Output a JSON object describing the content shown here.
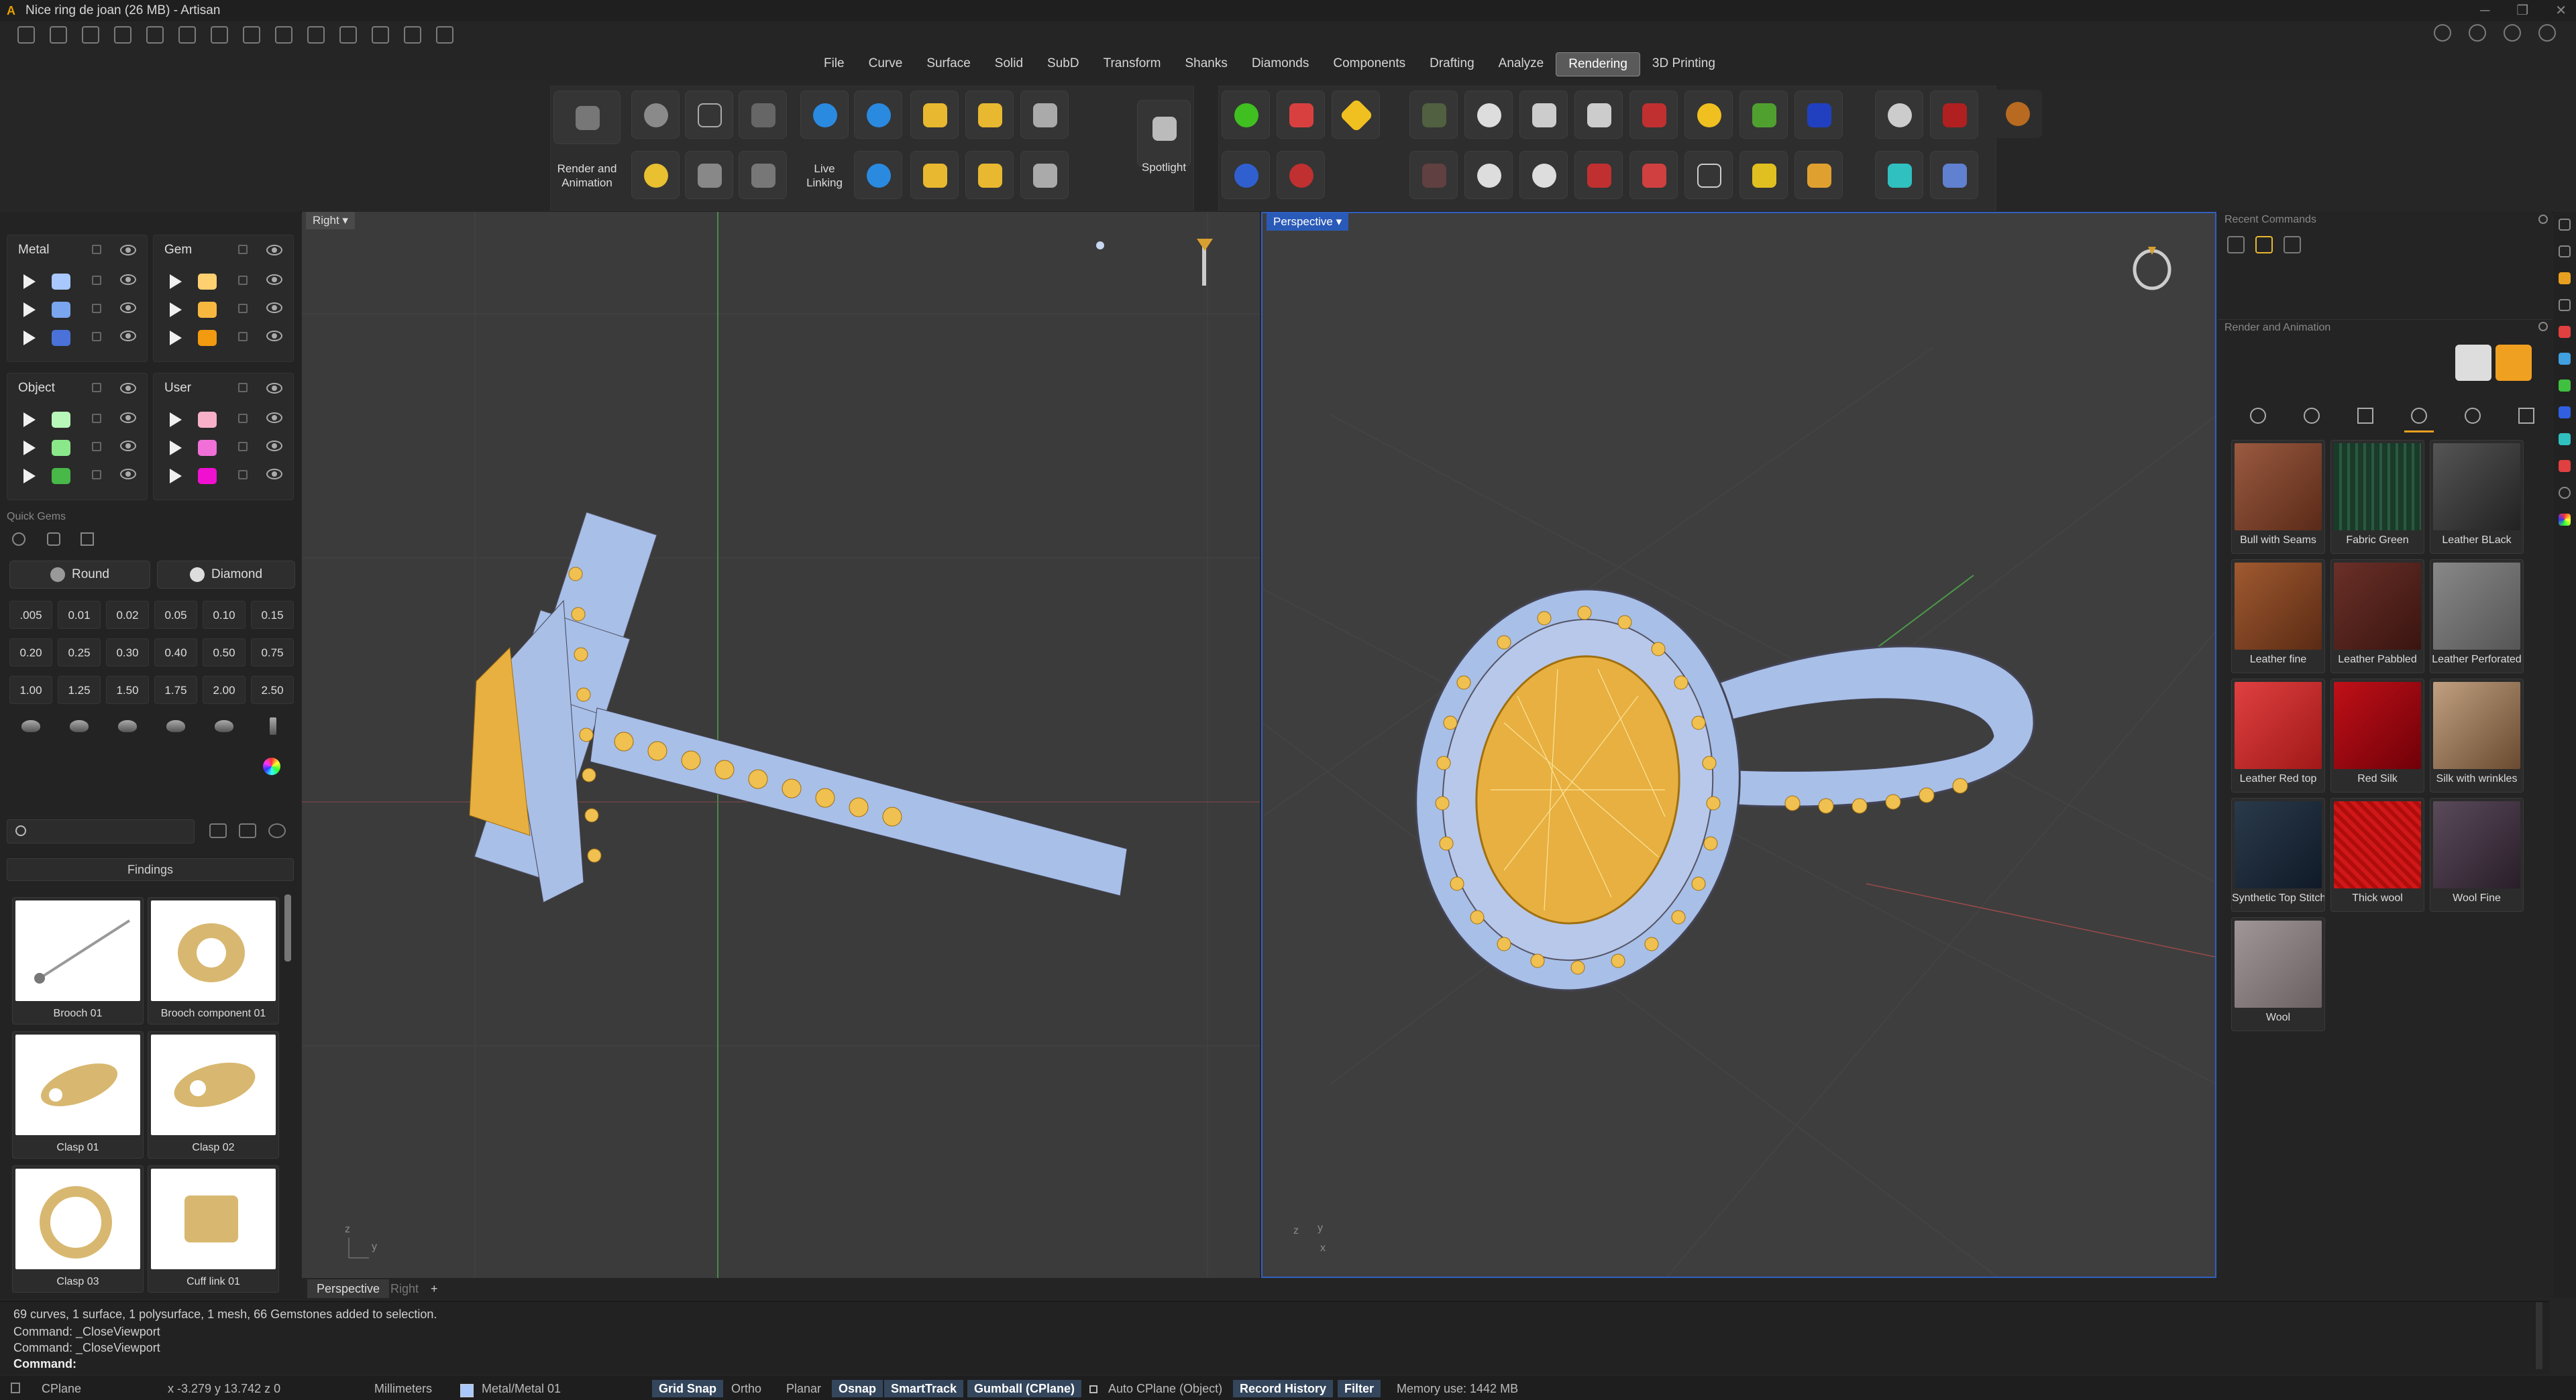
{
  "titlebar": {
    "title": "Nice ring de joan (26 MB) - Artisan"
  },
  "menu": [
    "File",
    "Curve",
    "Surface",
    "Solid",
    "SubD",
    "Transform",
    "Shanks",
    "Diamonds",
    "Components",
    "Drafting",
    "Analyze",
    "Rendering",
    "3D Printing"
  ],
  "active_menu": "Rendering",
  "ribbon": {
    "render_label": "Render and\nAnimation",
    "live_label": "Live\nLinking",
    "spotlight_label": "Spotlight"
  },
  "layers": {
    "metal": {
      "title": "Metal",
      "colors": [
        "#a8c8ff",
        "#7aa6f0",
        "#4a72d8"
      ]
    },
    "gem": {
      "title": "Gem",
      "colors": [
        "#ffd070",
        "#f8b840",
        "#f29a10"
      ]
    },
    "object": {
      "title": "Object",
      "colors": [
        "#b8f8b8",
        "#8ae88a",
        "#48b848"
      ]
    },
    "user": {
      "title": "User",
      "colors": [
        "#f8b0c8",
        "#f070d8",
        "#f010d0"
      ]
    }
  },
  "quickgems": {
    "header": "Quick Gems",
    "cut": "Round",
    "material": "Diamond",
    "sizes": [
      ".005",
      "0.01",
      "0.02",
      "0.05",
      "0.10",
      "0.15",
      "0.20",
      "0.25",
      "0.30",
      "0.40",
      "0.50",
      "0.75",
      "1.00",
      "1.25",
      "1.50",
      "1.75",
      "2.00",
      "2.50"
    ]
  },
  "library": {
    "search_placeholder": "",
    "category": "Findings",
    "items": [
      "Brooch 01",
      "Brooch component 01",
      "Clasp 01",
      "Clasp 02",
      "Clasp 03",
      "Cuff link 01"
    ]
  },
  "viewports": {
    "left": "Right",
    "right": "Perspective",
    "tabs": [
      "Perspective",
      "Right"
    ]
  },
  "recent_commands": {
    "header": "Recent Commands"
  },
  "render_panel": {
    "header": "Render and Animation",
    "materials": [
      {
        "name": "Bull with Seams",
        "color": "#7a4530"
      },
      {
        "name": "Fabric Green",
        "color": "#1a3a2a"
      },
      {
        "name": "Leather BLack",
        "color": "#3a3a3a"
      },
      {
        "name": "Leather fine",
        "color": "#8a4a2a"
      },
      {
        "name": "Leather Pabbled",
        "color": "#5a2a22"
      },
      {
        "name": "Leather Perforated",
        "color": "#6a6a6a"
      },
      {
        "name": "Leather Red top",
        "color": "#c82a2a"
      },
      {
        "name": "Red Silk",
        "color": "#a00810"
      },
      {
        "name": "Silk with wrinkles",
        "color": "#a08060"
      },
      {
        "name": "Synthetic Top Stitch",
        "color": "#1e2a3a"
      },
      {
        "name": "Thick wool",
        "color": "#d01818"
      },
      {
        "name": "Wool Fine",
        "color": "#4a3a4a"
      },
      {
        "name": "Wool",
        "color": "#8a7e80"
      }
    ]
  },
  "command_history": [
    "69 curves, 1 surface, 1 polysurface, 1 mesh, 66 Gemstones added to selection.",
    "Command: _CloseViewport",
    "Command: _CloseViewport"
  ],
  "command_prompt": "Command:",
  "status": {
    "cplane": "CPlane",
    "coords": "x -3.279  y 13.742  z 0",
    "units": "Millimeters",
    "layer": "Metal/Metal 01",
    "grid_snap": "Grid Snap",
    "ortho": "Ortho",
    "planar": "Planar",
    "osnap": "Osnap",
    "smarttrack": "SmartTrack",
    "gumball": "Gumball (CPlane)",
    "autocplane": "Auto CPlane (Object)",
    "record": "Record History",
    "filter": "Filter",
    "memory": "Memory use: 1442 MB"
  }
}
